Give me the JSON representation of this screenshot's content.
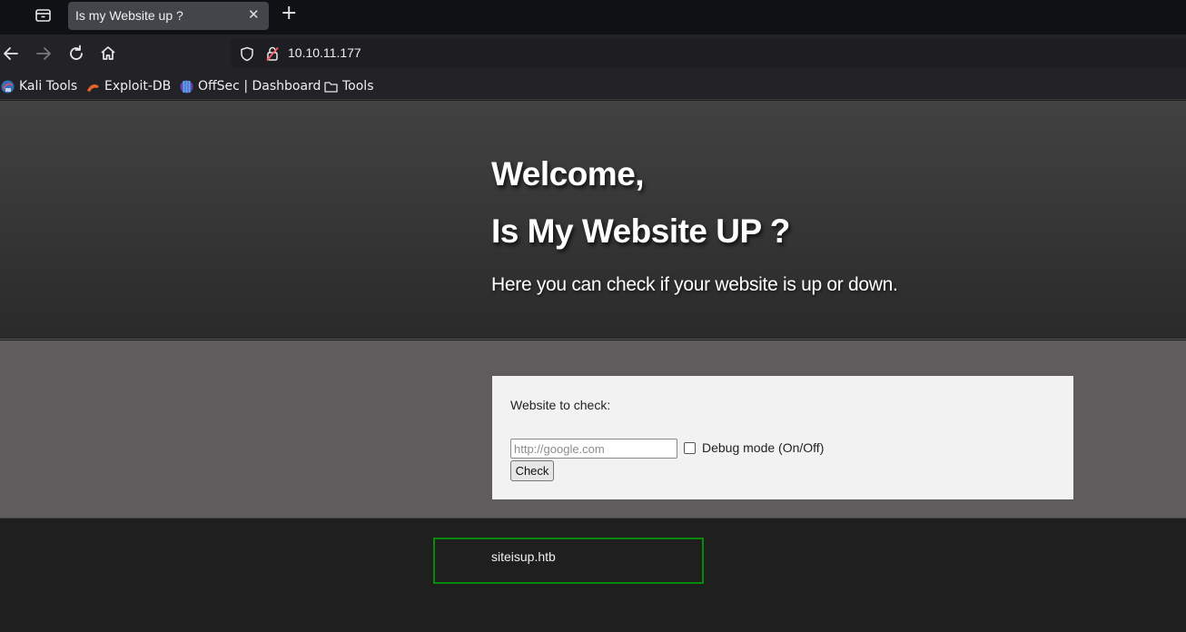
{
  "browser": {
    "tab_title": "Is my Website up ?",
    "tab_close": "✕",
    "new_tab": "+",
    "url": "10.10.11.177",
    "bookmarks": [
      {
        "label": "Kali Tools",
        "icon": "kali-icon"
      },
      {
        "label": "Exploit-DB",
        "icon": "exploitdb-icon"
      },
      {
        "label": "OffSec | Dashboard",
        "icon": "offsec-icon"
      },
      {
        "label": "Tools",
        "icon": "folder-icon"
      }
    ]
  },
  "hero": {
    "heading_line1": "Welcome,",
    "heading_line2": "Is My Website UP ?",
    "subtitle": "Here you can check if your website is up or down."
  },
  "form": {
    "label": "Website to check:",
    "input_placeholder": "http://google.com",
    "input_value": "",
    "debug_label": "Debug mode (On/Off)",
    "debug_checked": false,
    "submit_label": "Check"
  },
  "footer": {
    "text": "siteisup.htb",
    "highlight_color": "#0a8a0a"
  }
}
